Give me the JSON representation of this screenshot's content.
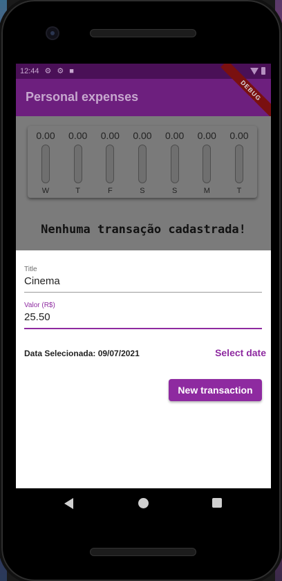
{
  "status_bar": {
    "time": "12:44"
  },
  "app_bar": {
    "title": "Personal expenses",
    "add_icon": "+",
    "debug_banner": "DEBUG"
  },
  "chart_data": {
    "type": "bar",
    "categories": [
      "W",
      "T",
      "F",
      "S",
      "S",
      "M",
      "T"
    ],
    "values": [
      0.0,
      0.0,
      0.0,
      0.0,
      0.0,
      0.0,
      0.0
    ],
    "value_labels": [
      "0.00",
      "0.00",
      "0.00",
      "0.00",
      "0.00",
      "0.00",
      "0.00"
    ],
    "ylim": [
      0,
      1
    ]
  },
  "empty_message": "Nenhuma transação cadastrada!",
  "form": {
    "title_label": "Title",
    "title_value": "Cinema",
    "value_label": "Valor (R$)",
    "value_value": "25.50",
    "date_text": "Data Selecionada: 09/07/2021",
    "select_date_label": "Select date",
    "submit_label": "New transaction"
  },
  "colors": {
    "primary": "#8e2aa0",
    "app_bar": "#6d1f7e",
    "status_bar": "#4a1057"
  }
}
